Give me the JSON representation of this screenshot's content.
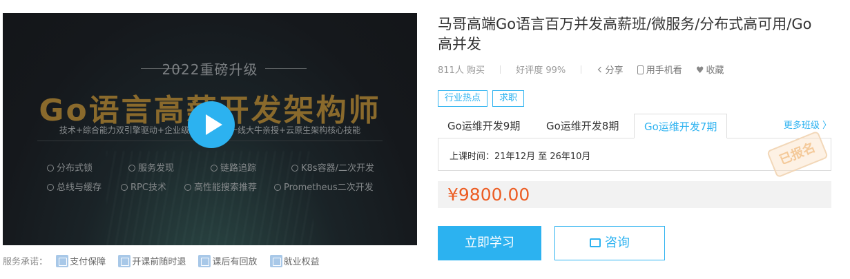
{
  "banner": {
    "year": "2022重磅升级",
    "headline": "Go语言高薪开发架构师",
    "subline": "技术+综合能力双引擎驱动+企业级实战案例+一线大牛亲授+云原生架构核心技能",
    "features_row1": [
      "分布式锁",
      "服务发现",
      "链路追踪",
      "K8s容器/二次开发"
    ],
    "features_row2": [
      "总线与缓存",
      "RPC技术",
      "高性能搜索推荐",
      "Prometheus二次开发"
    ]
  },
  "promise": {
    "label": "服务承诺：",
    "items": [
      "支付保障",
      "开课前随时退",
      "课后有回放",
      "就业权益"
    ]
  },
  "course": {
    "title": "马哥高端Go语言百万并发高薪班/微服务/分布式高可用/Go高并发",
    "buyers": "811人 购买",
    "rating": "好评度 99%",
    "share": "分享",
    "mobile": "用手机看",
    "favorite": "收藏",
    "tags": [
      "行业热点",
      "求职"
    ]
  },
  "classes": {
    "tabs": [
      "Go运维开发9期",
      "Go运维开发8期",
      "Go运维开发7期"
    ],
    "active_index": 2,
    "more": "更多班级 〉",
    "term": "上课时间：21年12月 至 26年10月",
    "stamp": "已报名"
  },
  "price": "¥9800.00",
  "actions": {
    "study": "立即学习",
    "consult": "咨询"
  },
  "colors": {
    "accent": "#2cb2f0",
    "price": "#ec5d24",
    "headline_gold": "#8a6a2c"
  }
}
